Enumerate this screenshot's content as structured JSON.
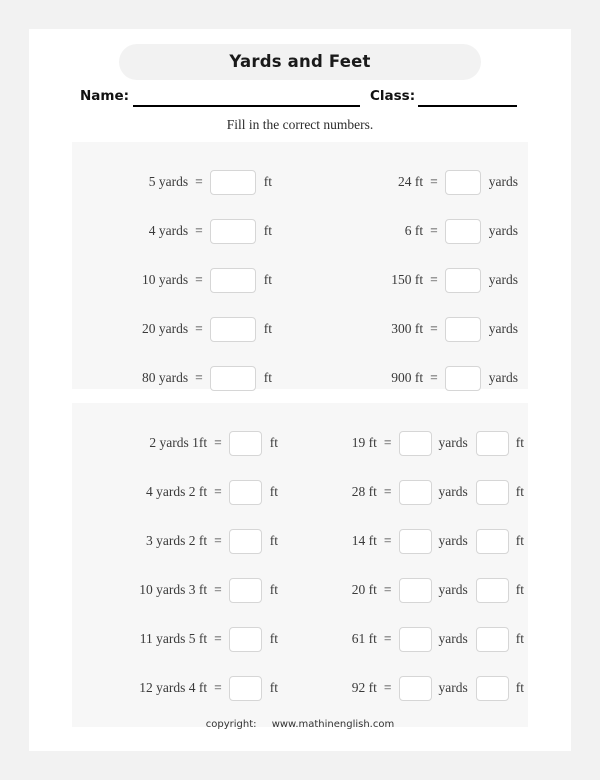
{
  "header": {
    "title": "Yards and Feet",
    "name_label": "Name:",
    "class_label": "Class:",
    "instruction": "Fill in the correct numbers."
  },
  "footer": {
    "copyright_label": "copyright:",
    "site": "www.mathinenglish.com"
  },
  "symbols": {
    "equals": "=",
    "ft": "ft",
    "yards": "yards"
  },
  "section1": {
    "rows": [
      {
        "left": {
          "question": "5 yards",
          "equals": "=",
          "unit": "ft"
        },
        "right": {
          "question": "24 ft",
          "equals": "=",
          "unit": "yards"
        }
      },
      {
        "left": {
          "question": "4 yards",
          "equals": "=",
          "unit": "ft"
        },
        "right": {
          "question": "6 ft",
          "equals": "=",
          "unit": "yards"
        }
      },
      {
        "left": {
          "question": "10 yards",
          "equals": "=",
          "unit": "ft"
        },
        "right": {
          "question": "150 ft",
          "equals": "=",
          "unit": "yards"
        }
      },
      {
        "left": {
          "question": "20 yards",
          "equals": "=",
          "unit": "ft"
        },
        "right": {
          "question": "300 ft",
          "equals": "=",
          "unit": "yards"
        }
      },
      {
        "left": {
          "question": "80 yards",
          "equals": "=",
          "unit": "ft"
        },
        "right": {
          "question": "900 ft",
          "equals": "=",
          "unit": "yards"
        }
      }
    ]
  },
  "section2": {
    "rows": [
      {
        "left": {
          "question": "2 yards 1ft",
          "equals": "=",
          "unit": "ft"
        },
        "right": {
          "question": "19 ft",
          "equals": "=",
          "unit1": "yards",
          "unit2": "ft"
        }
      },
      {
        "left": {
          "question": "4 yards 2 ft",
          "equals": "=",
          "unit": "ft"
        },
        "right": {
          "question": "28 ft",
          "equals": "=",
          "unit1": "yards",
          "unit2": "ft"
        }
      },
      {
        "left": {
          "question": "3 yards 2 ft",
          "equals": "=",
          "unit": "ft"
        },
        "right": {
          "question": "14 ft",
          "equals": "=",
          "unit1": "yards",
          "unit2": "ft"
        }
      },
      {
        "left": {
          "question": "10 yards 3 ft",
          "equals": "=",
          "unit": "ft"
        },
        "right": {
          "question": "20 ft",
          "equals": "=",
          "unit1": "yards",
          "unit2": "ft"
        }
      },
      {
        "left": {
          "question": "11 yards 5 ft",
          "equals": "=",
          "unit": "ft"
        },
        "right": {
          "question": "61 ft",
          "equals": "=",
          "unit1": "yards",
          "unit2": "ft"
        }
      },
      {
        "left": {
          "question": "12 yards 4 ft",
          "equals": "=",
          "unit": "ft"
        },
        "right": {
          "question": "92 ft",
          "equals": "=",
          "unit1": "yards",
          "unit2": "ft"
        }
      }
    ]
  }
}
